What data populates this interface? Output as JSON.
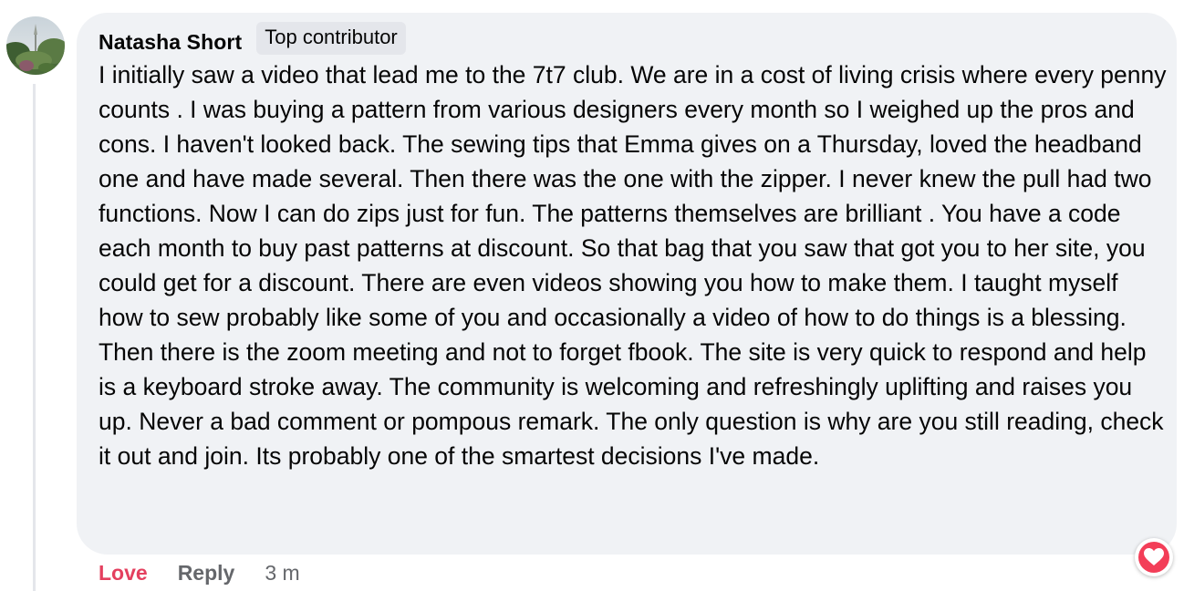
{
  "comment": {
    "author": "Natasha Short",
    "badge": "Top contributor",
    "text": "I initially saw a video that lead me to the 7t7 club. We are in a cost of living crisis where every penny counts . I was buying a pattern from various designers every month so I weighed up the pros and cons. I haven't looked back. The sewing tips that Emma gives on a Thursday, loved the headband one and have made several. Then there was the one with the zipper. I never knew the pull had two functions. Now I can do zips just for fun. The patterns themselves are brilliant . You have a code each month to buy past patterns at discount. So that bag that you saw that got you to her site, you could get for a discount. There are even videos showing you how to make them. I taught myself how to sew probably like some of you and occasionally a video of how to do things is a blessing. Then there is the zoom meeting and not to forget fbook. The site is very quick to respond and help is a keyboard stroke away. The community is welcoming and refreshingly uplifting and raises you up. Never a bad comment or pompous remark. The only question is why are you still reading, check it out and join. Its probably one of the smartest decisions I've made.",
    "reaction_icon": "heart-icon"
  },
  "actions": {
    "love_label": "Love",
    "reply_label": "Reply",
    "timestamp": "3 m"
  },
  "colors": {
    "bubble_bg": "#f0f2f5",
    "love": "#e4405f",
    "muted": "#65676b",
    "reaction": "#f33e58"
  }
}
